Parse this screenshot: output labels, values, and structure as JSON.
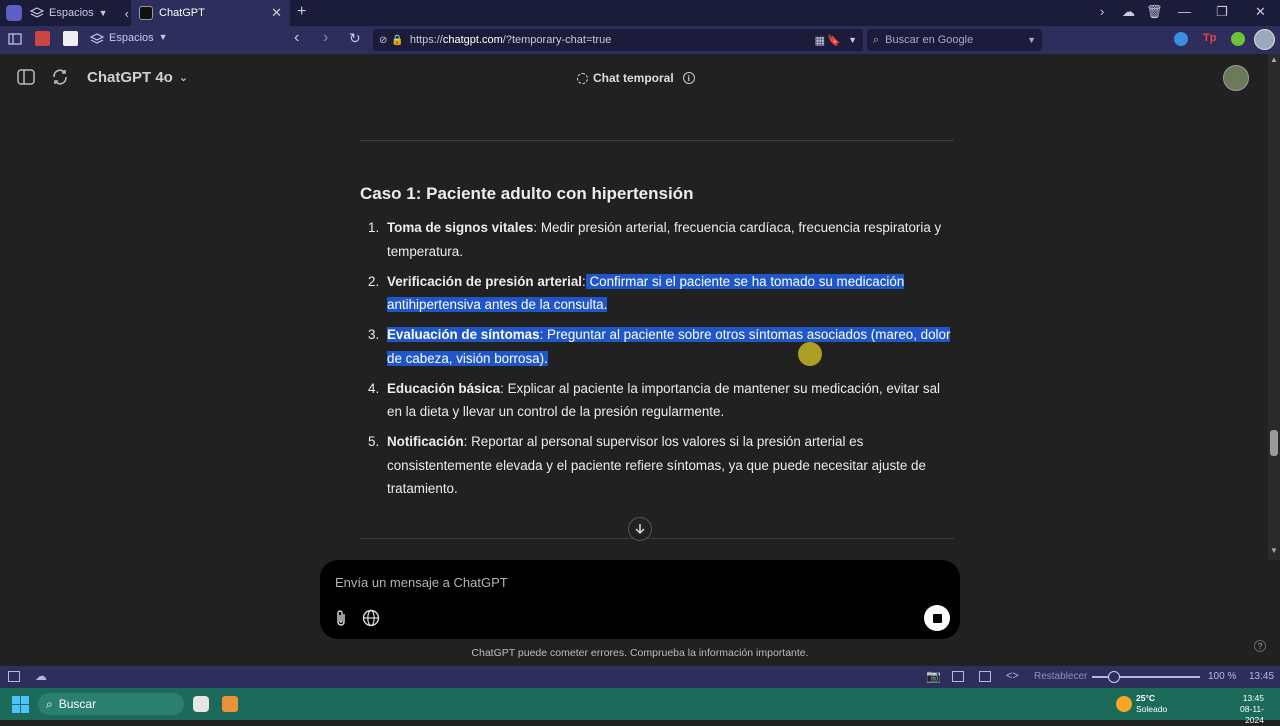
{
  "browser": {
    "spaces_tab_label": "Espacios",
    "active_tab_title": "ChatGPT",
    "spaces_button_label": "Espacios",
    "url_prefix": "https://",
    "url_host": "chatgpt.com",
    "url_rest": "/?temporary-chat=true",
    "search_placeholder": "Buscar en Google"
  },
  "header": {
    "model_label": "ChatGPT 4o",
    "temporary_chat_label": "Chat temporal"
  },
  "content": {
    "case_title": "Caso 1: Paciente adulto con hipertensión",
    "steps": [
      {
        "num": "1.",
        "title": "Toma de signos vitales",
        "sep": ":",
        "text": " Medir presión arterial, frecuencia cardíaca, frecuencia respiratoria y temperatura."
      },
      {
        "num": "2.",
        "title": "Verificación de presión arterial",
        "sep": ":",
        "text": " Confirmar si el paciente se ha tomado su medicación antihipertensiva antes de la consulta."
      },
      {
        "num": "3.",
        "title": "Evaluación de síntomas",
        "sep": ":",
        "text": " Preguntar al paciente sobre otros síntomas asociados (mareo, dolor de cabeza, visión borrosa)."
      },
      {
        "num": "4.",
        "title": "Educación básica",
        "sep": ":",
        "text": " Explicar al paciente la importancia de mantener su medicación, evitar sal en la dieta y llevar un control de la presión regularmente."
      },
      {
        "num": "5.",
        "title": "Notificación",
        "sep": ":",
        "text": " Reportar al personal supervisor los valores si la presión arterial es consistentemente elevada y el paciente refiere síntomas, ya que puede necesitar ajuste de tratamiento."
      }
    ]
  },
  "composer": {
    "placeholder": "Envía un mensaje a ChatGPT"
  },
  "disclaimer": "ChatGPT puede cometer errores. Comprueba la información importante.",
  "statusbar": {
    "reset_label": "Restablecer",
    "zoom": "100 %",
    "time": "13:45"
  },
  "taskbar": {
    "search_label": "Buscar",
    "weather_temp": "25°C",
    "weather_desc": "Soleado",
    "clock_time": "13:45",
    "clock_date": "08-11-2024"
  },
  "colors": {
    "selection": "#1f57c8",
    "browser_chrome": "#2e2e5c",
    "taskbar": "#1c6b5a"
  }
}
